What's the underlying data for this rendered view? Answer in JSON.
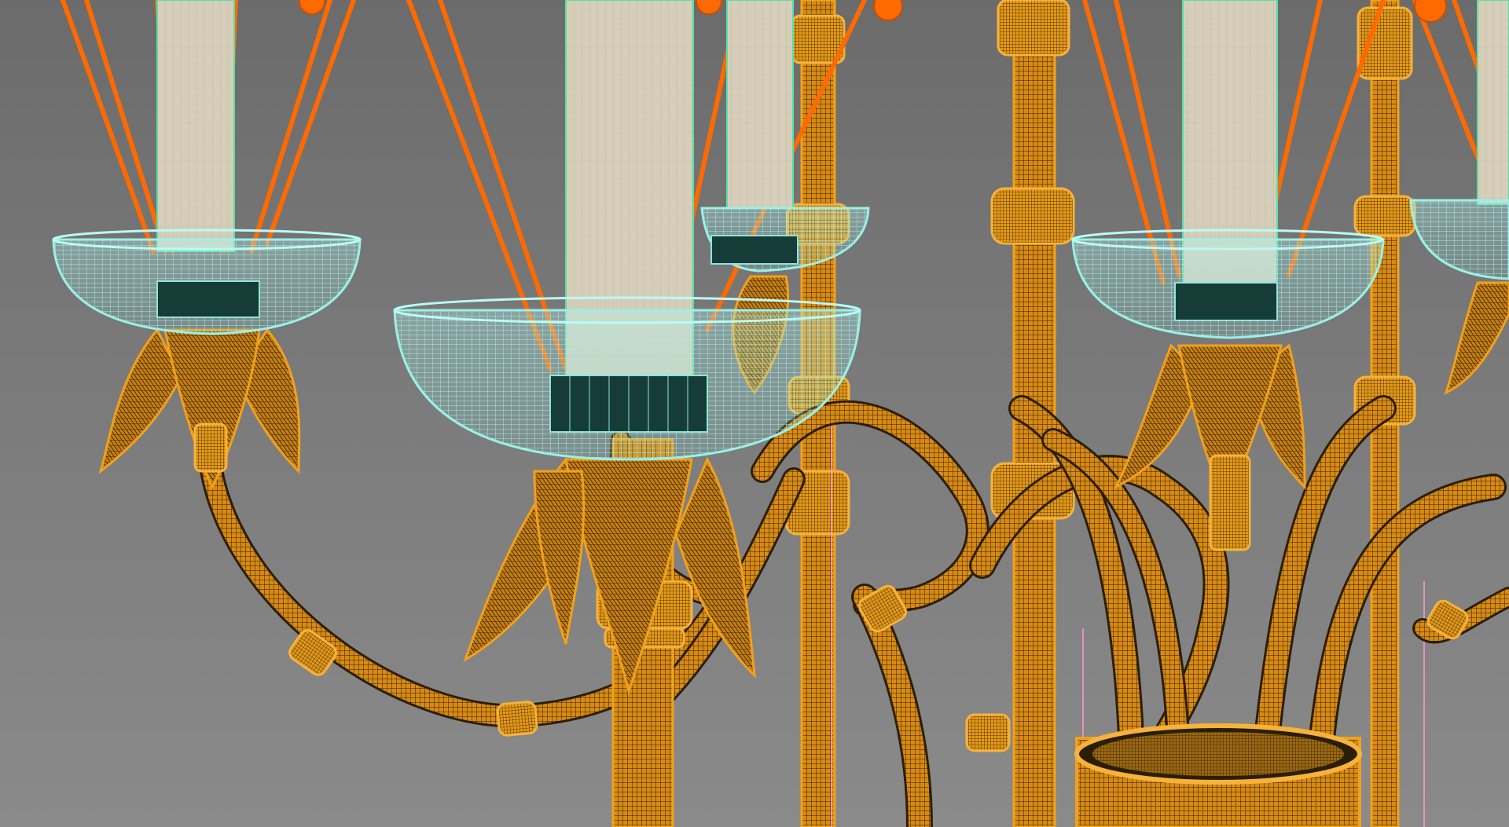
{
  "viewport": {
    "name": "3d-wireframe-viewport",
    "background_top": "#6b6b6b",
    "background_bottom": "#8a8a8a"
  },
  "model": {
    "subject": "chandelier",
    "colors": {
      "frame_wire": "#f0a11c",
      "frame_dark": "#2b1e08",
      "cup_wire": "#8fe3dc",
      "rod_wire": "#ff6a00",
      "candle_fill": "#d9cdb8",
      "candle_wire": "#56e0a8",
      "helper_line": "#ff9ad0"
    },
    "candles": [
      {
        "id": "left",
        "glow": "off"
      },
      {
        "id": "center-front",
        "glow": "off"
      },
      {
        "id": "center-back",
        "glow": "off"
      },
      {
        "id": "right",
        "glow": "off"
      },
      {
        "id": "far-right",
        "glow": "off"
      }
    ]
  }
}
